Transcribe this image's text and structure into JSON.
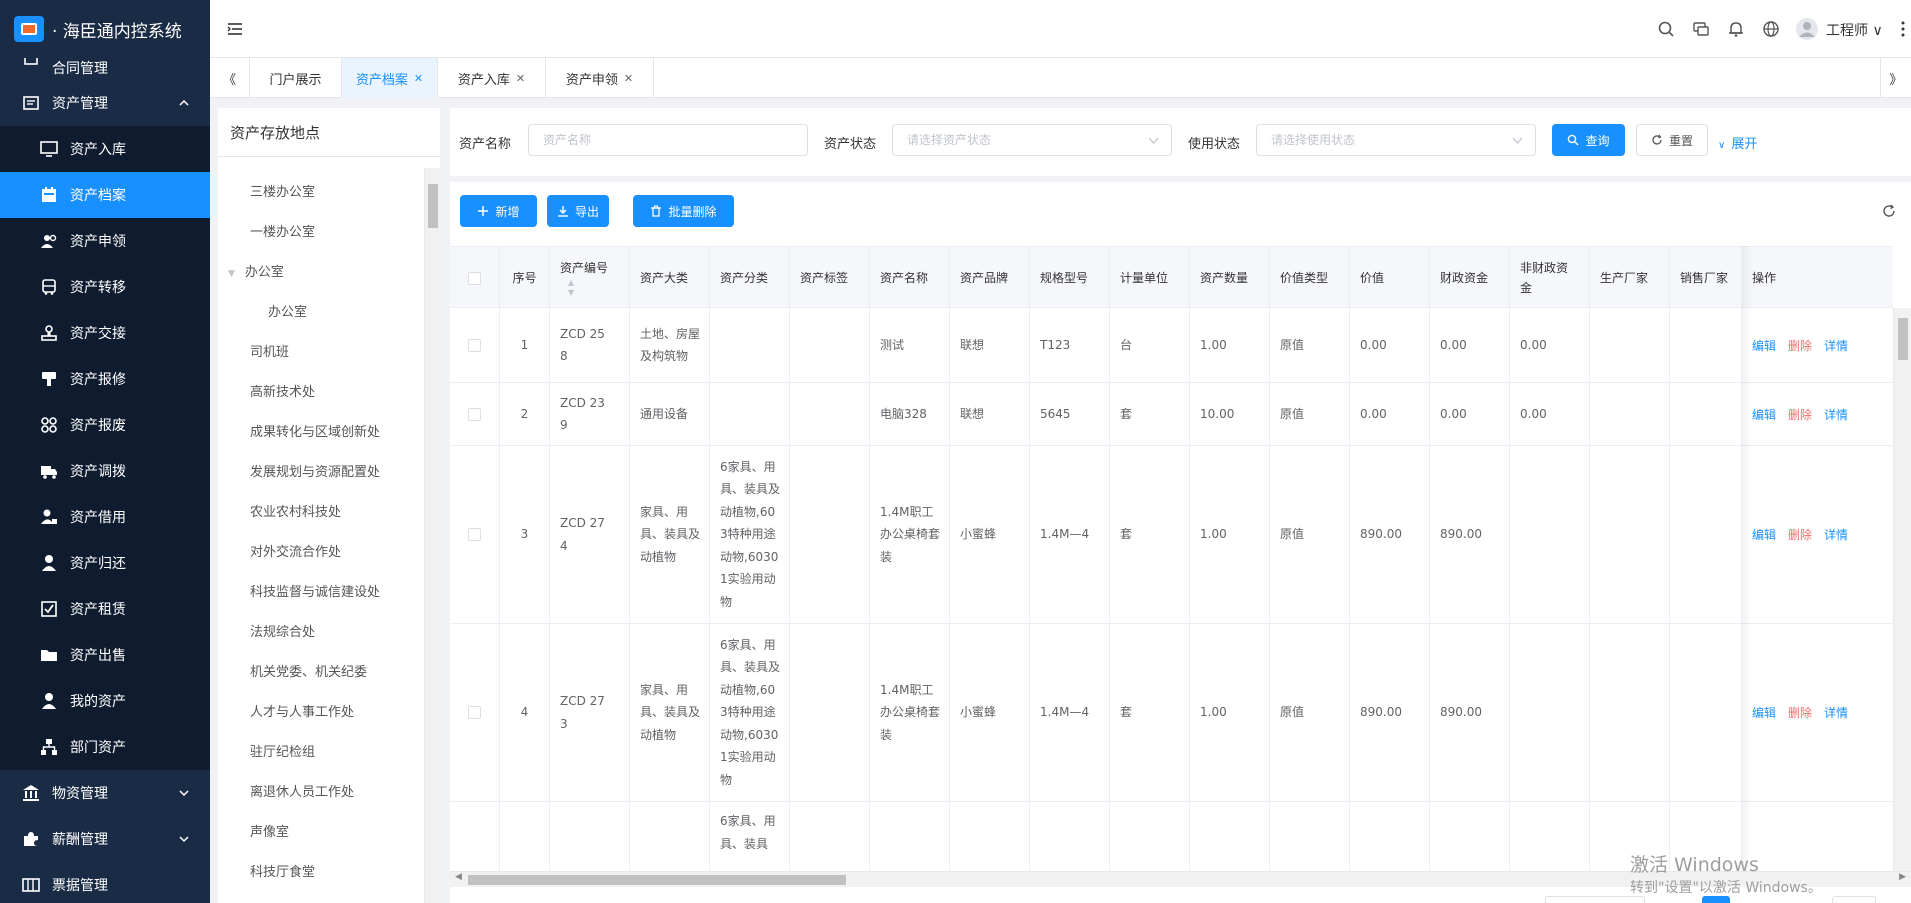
{
  "app": {
    "title": "· 海臣通内控系统"
  },
  "sidebar": {
    "items": [
      {
        "label": "合同管理",
        "icon": "contract-icon",
        "level": "top",
        "partial": true
      },
      {
        "label": "资产管理",
        "icon": "asset-management-icon",
        "level": "top",
        "expanded": true
      },
      {
        "label": "资产入库",
        "icon": "monitor-icon",
        "level": "sub"
      },
      {
        "label": "资产档案",
        "icon": "calendar-icon",
        "level": "sub",
        "active": true
      },
      {
        "label": "资产申领",
        "icon": "users-icon",
        "level": "sub"
      },
      {
        "label": "资产转移",
        "icon": "bus-icon",
        "level": "sub"
      },
      {
        "label": "资产交接",
        "icon": "stamp-icon",
        "level": "sub"
      },
      {
        "label": "资产报修",
        "icon": "repair-icon",
        "level": "sub"
      },
      {
        "label": "资产报废",
        "icon": "grid-icon",
        "level": "sub"
      },
      {
        "label": "资产调拨",
        "icon": "truck-icon",
        "level": "sub"
      },
      {
        "label": "资产借用",
        "icon": "user-lock-icon",
        "level": "sub"
      },
      {
        "label": "资产归还",
        "icon": "user-icon",
        "level": "sub"
      },
      {
        "label": "资产租赁",
        "icon": "checkbox-icon",
        "level": "sub"
      },
      {
        "label": "资产出售",
        "icon": "folder-icon",
        "level": "sub"
      },
      {
        "label": "我的资产",
        "icon": "person-icon",
        "level": "sub"
      },
      {
        "label": "部门资产",
        "icon": "org-chart-icon",
        "level": "sub"
      },
      {
        "label": "物资管理",
        "icon": "bank-icon",
        "level": "top"
      },
      {
        "label": "薪酬管理",
        "icon": "puzzle-icon",
        "level": "top"
      },
      {
        "label": "票据管理",
        "icon": "ticket-icon",
        "level": "top"
      }
    ]
  },
  "header": {
    "user": "工程师"
  },
  "tabs": [
    {
      "label": "门户展示",
      "closable": false
    },
    {
      "label": "资产档案",
      "closable": true,
      "active": true
    },
    {
      "label": "资产入库",
      "closable": true
    },
    {
      "label": "资产申领",
      "closable": true
    }
  ],
  "tree": {
    "title": "资产存放地点",
    "items": [
      {
        "label": "三楼办公室"
      },
      {
        "label": "一楼办公室"
      },
      {
        "label": "办公室",
        "expanded": true
      },
      {
        "label": "办公室",
        "child": true
      },
      {
        "label": "司机班"
      },
      {
        "label": "高新技术处"
      },
      {
        "label": "成果转化与区域创新处"
      },
      {
        "label": "发展规划与资源配置处"
      },
      {
        "label": "农业农村科技处"
      },
      {
        "label": "对外交流合作处"
      },
      {
        "label": "科技监督与诚信建设处"
      },
      {
        "label": "法规综合处"
      },
      {
        "label": "机关党委、机关纪委"
      },
      {
        "label": "人才与人事工作处"
      },
      {
        "label": "驻厅纪检组"
      },
      {
        "label": "离退休人员工作处"
      },
      {
        "label": "声像室"
      },
      {
        "label": "科技厅食堂"
      }
    ]
  },
  "search": {
    "fields": [
      {
        "label": "资产名称",
        "placeholder": "资产名称"
      },
      {
        "label": "资产状态",
        "placeholder": "请选择资产状态"
      },
      {
        "label": "使用状态",
        "placeholder": "请选择使用状态"
      }
    ],
    "query": "查询",
    "reset": "重置",
    "expand": "展开"
  },
  "toolbar": {
    "add": "新增",
    "export": "导出",
    "batch_delete": "批量删除"
  },
  "table": {
    "headers": [
      "序号",
      "资产编号",
      "资产大类",
      "资产分类",
      "资产标签",
      "资产名称",
      "资产品牌",
      "规格型号",
      "计量单位",
      "资产数量",
      "价值类型",
      "价值",
      "财政资金",
      "非财政资金",
      "生产厂家",
      "销售厂家",
      "操作"
    ],
    "actions": {
      "edit": "编辑",
      "delete": "删除",
      "detail": "详情"
    },
    "rows": [
      {
        "seq": "1",
        "code": "ZCD 258",
        "category": "土地、房屋及构筑物",
        "classification": "",
        "tag": "",
        "name": "测试",
        "brand": "联想",
        "model": "T123",
        "unit": "台",
        "qty": "1.00",
        "value_type": "原值",
        "value": "0.00",
        "fiscal": "0.00",
        "non_fiscal": "0.00",
        "manufacturer": "",
        "seller": ""
      },
      {
        "seq": "2",
        "code": "ZCD 239",
        "category": "通用设备",
        "classification": "",
        "tag": "",
        "name": "电脑328",
        "brand": "联想",
        "model": "5645",
        "unit": "套",
        "qty": "10.00",
        "value_type": "原值",
        "value": "0.00",
        "fiscal": "0.00",
        "non_fiscal": "0.00",
        "manufacturer": "",
        "seller": ""
      },
      {
        "seq": "3",
        "code": "ZCD 274",
        "category": "家具、用具、装具及动植物",
        "classification": "6家具、用具、装具及动植物,603特种用途动物,60301实验用动物",
        "tag": "",
        "name": "1.4M职工办公桌椅套装",
        "brand": "小蜜蜂",
        "model": "1.4M—4",
        "unit": "套",
        "qty": "1.00",
        "value_type": "原值",
        "value": "890.00",
        "fiscal": "890.00",
        "non_fiscal": "",
        "manufacturer": "",
        "seller": ""
      },
      {
        "seq": "4",
        "code": "ZCD 273",
        "category": "家具、用具、装具及动植物",
        "classification": "6家具、用具、装具及动植物,603特种用途动物,60301实验用动物",
        "tag": "",
        "name": "1.4M职工办公桌椅套装",
        "brand": "小蜜蜂",
        "model": "1.4M—4",
        "unit": "套",
        "qty": "1.00",
        "value_type": "原值",
        "value": "890.00",
        "fiscal": "890.00",
        "non_fiscal": "",
        "manufacturer": "",
        "seller": ""
      },
      {
        "seq": "",
        "code": "",
        "category": "",
        "classification": "6家具、用具、装具",
        "tag": "",
        "name": "",
        "brand": "",
        "model": "",
        "unit": "",
        "qty": "",
        "value_type": "",
        "value": "",
        "fiscal": "",
        "non_fiscal": "",
        "manufacturer": "",
        "seller": "",
        "partial": true
      }
    ]
  },
  "watermark": {
    "line1": "激活 Windows",
    "line2": "转到\"设置\"以激活 Windows。"
  }
}
